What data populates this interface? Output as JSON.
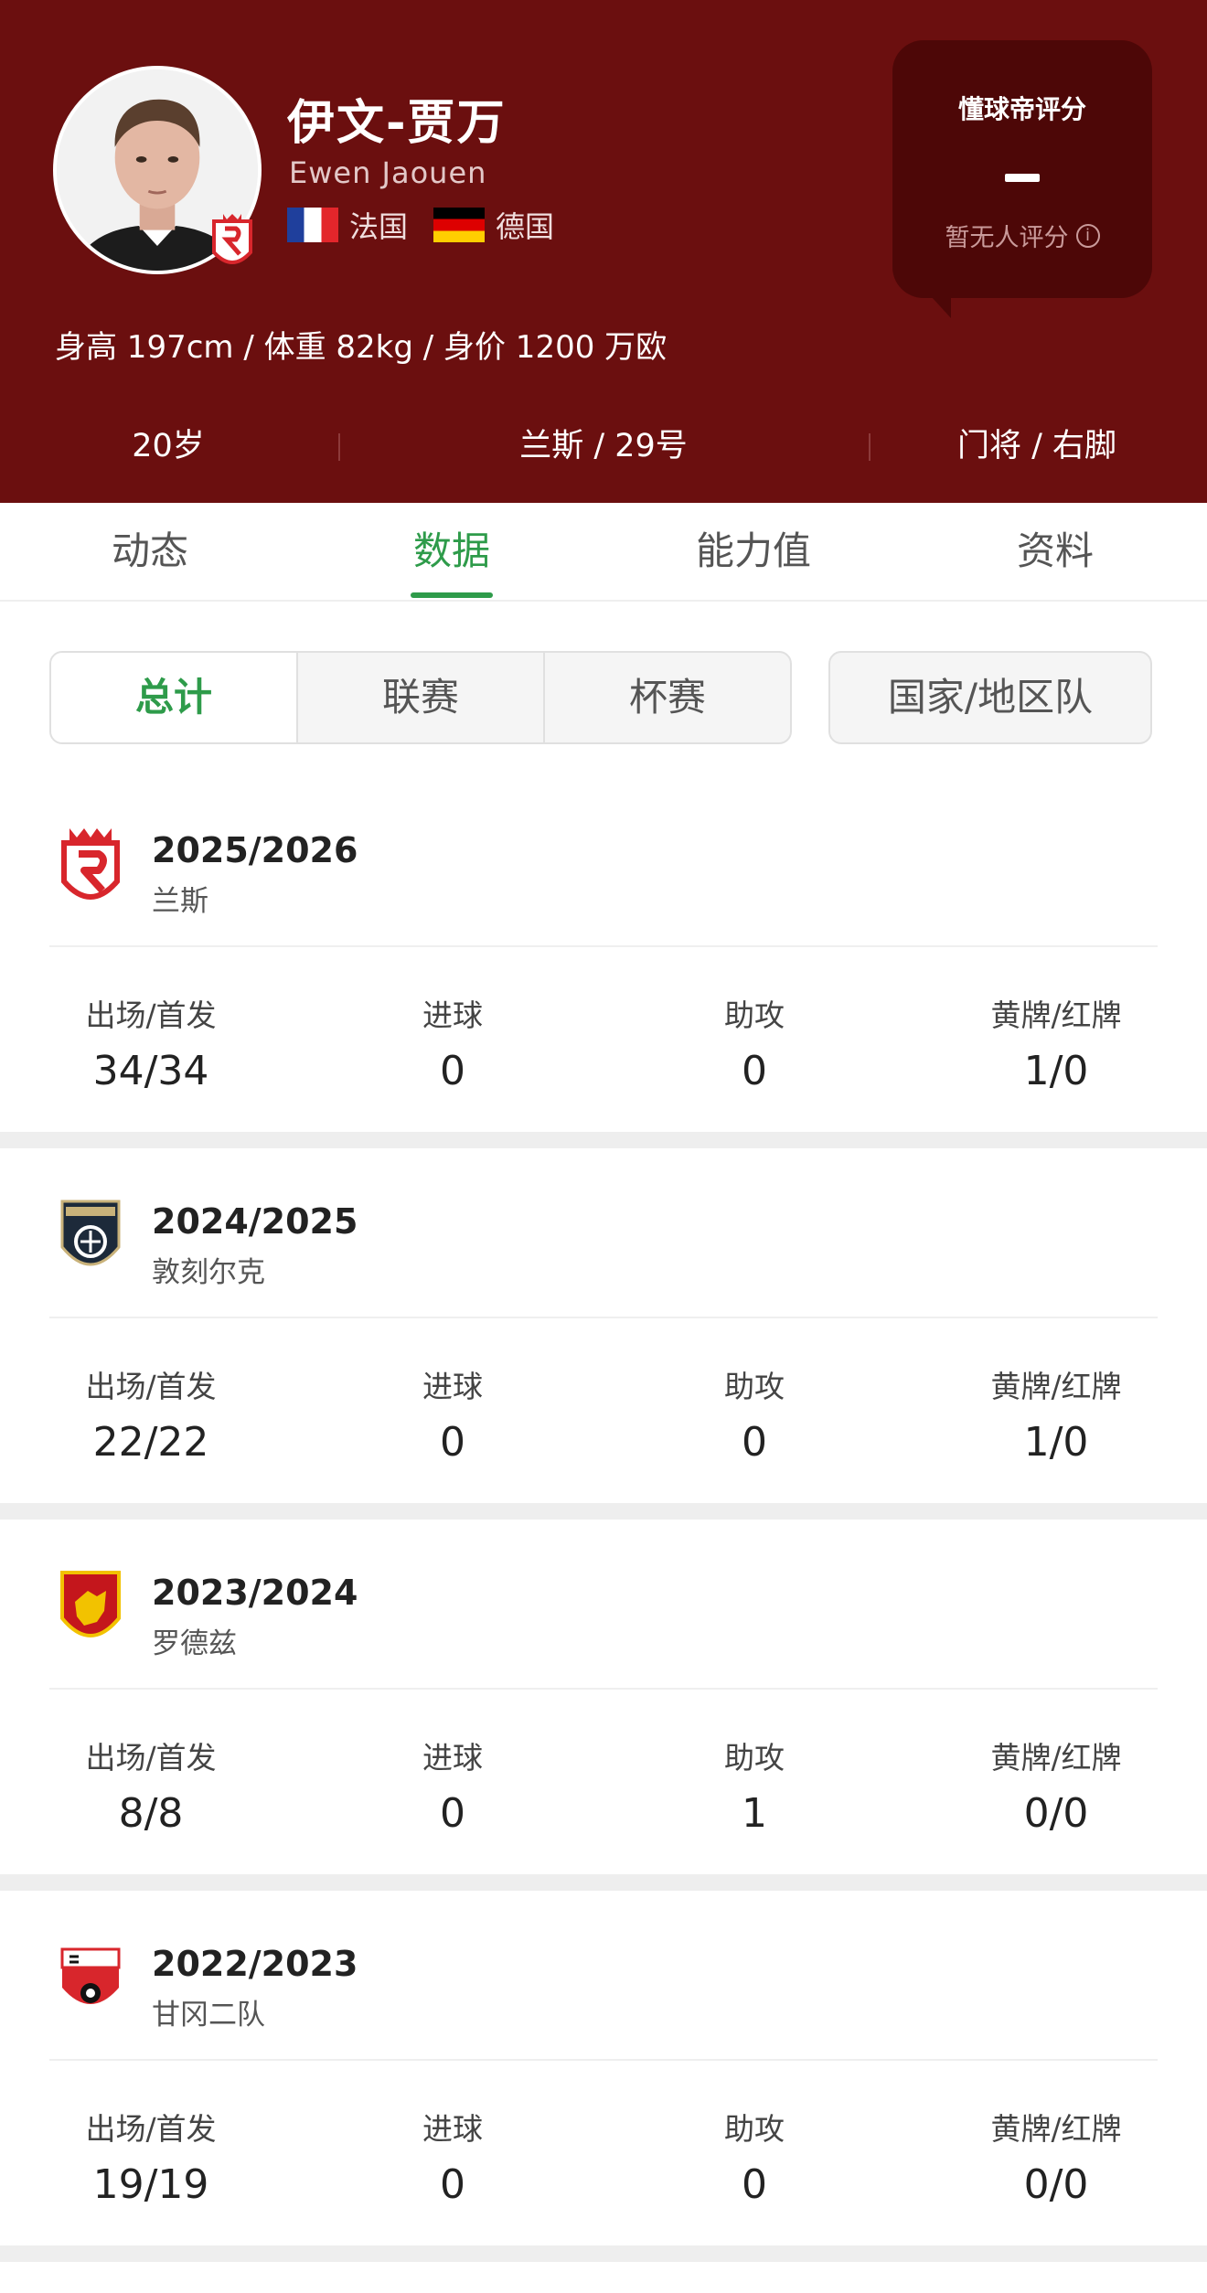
{
  "player": {
    "name_cn": "伊文-贾万",
    "name_en": "Ewen Jaouen",
    "nationalities": [
      {
        "flag": "france-flag",
        "label": "法国"
      },
      {
        "flag": "germany-flag",
        "label": "德国"
      }
    ],
    "bio": "身高 197cm / 体重 82kg / 身价 1200 万欧",
    "age": "20岁",
    "team_number": "兰斯 / 29号",
    "position_foot": "门将 / 右脚"
  },
  "rating": {
    "title": "懂球帝评分",
    "value": "—",
    "note": "暂无人评分"
  },
  "tabs": [
    "动态",
    "数据",
    "能力值",
    "资料"
  ],
  "active_tab": "数据",
  "filters": {
    "segments": [
      "总计",
      "联赛",
      "杯赛"
    ],
    "active": "总计",
    "national": "国家/地区队"
  },
  "stat_labels": {
    "apps": "出场/首发",
    "goals": "进球",
    "assists": "助攻",
    "cards": "黄牌/红牌"
  },
  "seasons": [
    {
      "season": "2025/2026",
      "club": "兰斯",
      "logo": "reims-logo",
      "apps": "34/34",
      "goals": "0",
      "assists": "0",
      "cards": "1/0"
    },
    {
      "season": "2024/2025",
      "club": "敦刻尔克",
      "logo": "dunkerque-logo",
      "apps": "22/22",
      "goals": "0",
      "assists": "0",
      "cards": "1/0"
    },
    {
      "season": "2023/2024",
      "club": "罗德兹",
      "logo": "rodez-logo",
      "apps": "8/8",
      "goals": "0",
      "assists": "1",
      "cards": "0/0"
    },
    {
      "season": "2022/2023",
      "club": "甘冈二队",
      "logo": "guingamp-logo",
      "apps": "19/19",
      "goals": "0",
      "assists": "0",
      "cards": "0/0"
    }
  ],
  "colors": {
    "header_bg": "#6b0f0f",
    "rating_bg": "#4d0707",
    "accent_green": "#2e9b4a"
  }
}
